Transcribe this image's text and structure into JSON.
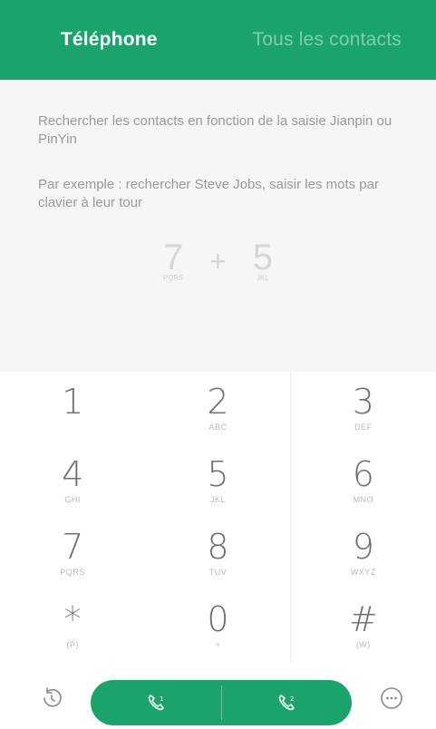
{
  "tabs": {
    "phone": "Téléphone",
    "contacts": "Tous les contacts"
  },
  "hint": {
    "line1": "Rechercher les contacts en fonction de la saisie Jianpin ou PinYin",
    "line2": "Par exemple : rechercher Steve Jobs, saisir les mots par clavier à leur tour",
    "example": {
      "first_digit": "7",
      "first_letters": "PQRS",
      "plus": "+",
      "second_digit": "5",
      "second_letters": "JKL"
    }
  },
  "keys": [
    {
      "digit": "1",
      "letters": ""
    },
    {
      "digit": "2",
      "letters": "ABC"
    },
    {
      "digit": "3",
      "letters": "DEF"
    },
    {
      "digit": "4",
      "letters": "GHI"
    },
    {
      "digit": "5",
      "letters": "JKL"
    },
    {
      "digit": "6",
      "letters": "MNO"
    },
    {
      "digit": "7",
      "letters": "PQRS"
    },
    {
      "digit": "8",
      "letters": "TUV"
    },
    {
      "digit": "9",
      "letters": "WXYZ"
    },
    {
      "digit": "*",
      "letters": "(P)"
    },
    {
      "digit": "0",
      "letters": "+"
    },
    {
      "digit": "#",
      "letters": "(W)"
    }
  ],
  "colors": {
    "accent": "#1aa36a",
    "icon_gray": "#8a8a8a"
  },
  "icons": {
    "history": "history-icon",
    "sim1_call": "call-sim1-icon",
    "sim2_call": "call-sim2-icon",
    "more": "more-icon"
  }
}
